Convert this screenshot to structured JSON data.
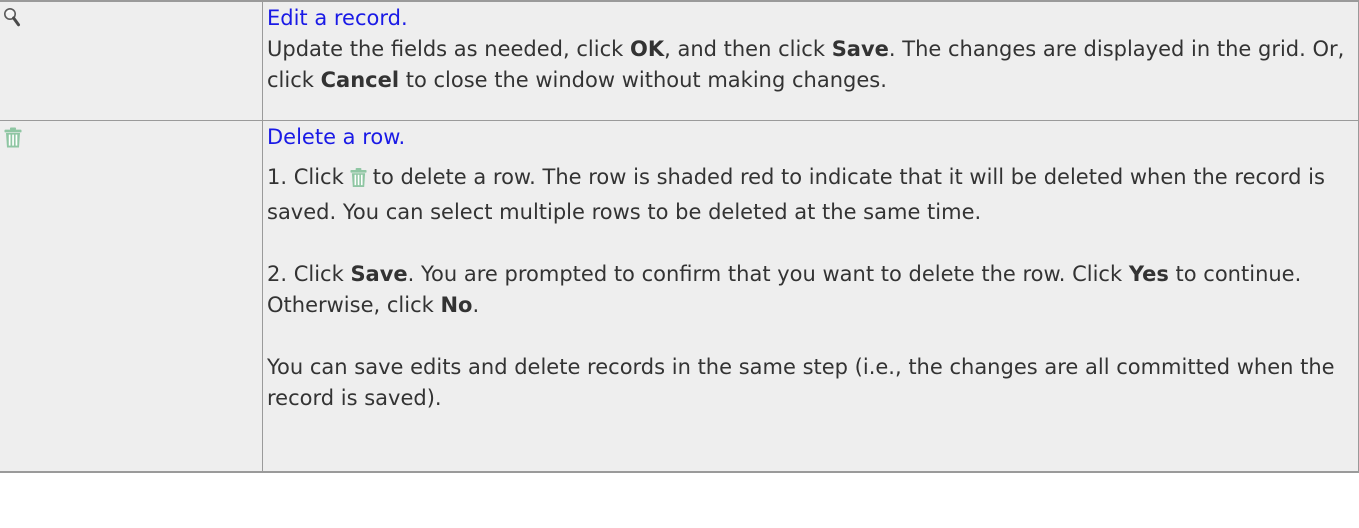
{
  "rows": [
    {
      "icon": "magnifier-icon",
      "link": "Edit a record.",
      "p1_a": "Update the fields as needed, click ",
      "p1_b": "OK",
      "p1_c": ", and then click ",
      "p1_d": "Save",
      "p1_e": ". The changes are displayed in the grid. Or, click ",
      "p1_f": "Cancel",
      "p1_g": " to close the window without making changes."
    },
    {
      "icon": "trash-icon",
      "link": "Delete a row.",
      "s1_a": "1. Click",
      "s1_b": "to delete a row. The row is shaded red to indicate that it will be deleted when the record is saved. You can select multiple rows to be deleted at the same time.",
      "s2_a": "2. Click ",
      "s2_b": "Save",
      "s2_c": ". You are prompted to confirm that you want to delete the row. Click ",
      "s2_d": "Yes",
      "s2_e": " to continue. Otherwise, click ",
      "s2_f": "No",
      "s2_g": ".",
      "s3": "You can save edits and delete records in the same step (i.e., the changes are all committed when the record is saved)."
    }
  ],
  "colors": {
    "link": "#1a1ae6",
    "text": "#333333",
    "cell_bg": "#eeeeee",
    "border": "#9a9a9a",
    "trash_icon": "#8fc6a3"
  }
}
